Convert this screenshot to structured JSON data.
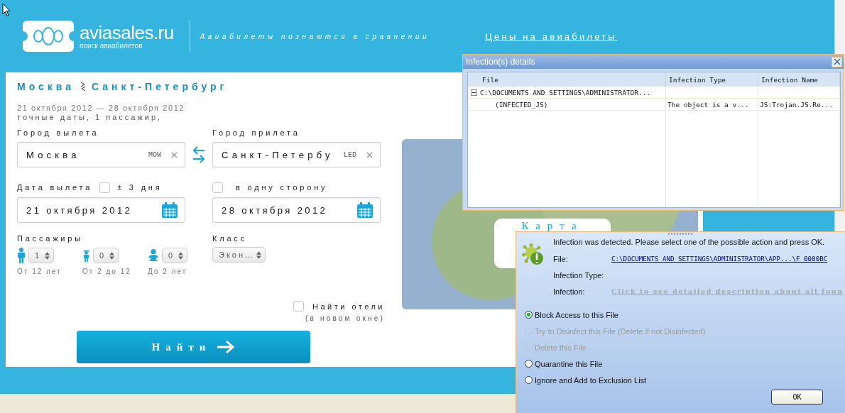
{
  "header": {
    "logo_text": "aviasales.ru",
    "logo_subtitle": "поиск авиабилетов",
    "tagline": "Авиабилеты познаются в сравнении",
    "prices_link": "Цены на авиабилеты"
  },
  "search": {
    "route_from": "Москва",
    "route_to": "Санкт-Петербург",
    "dates": "21 октября 2012  — 28 октября 2012",
    "summary": "точные даты, 1 пассажир,",
    "origin": {
      "label": "Город вылета",
      "value": "Москва",
      "code": "MOW"
    },
    "destination": {
      "label": "Город прилета",
      "value": "Санкт-Петербу",
      "code": "LED"
    },
    "depart": {
      "label": "Дата вылета",
      "value": "21 октября 2012"
    },
    "flex_dates": {
      "label": "± 3 дня",
      "checked": false
    },
    "one_way": {
      "label": "в одну сторону",
      "checked": false
    },
    "return": {
      "value": "28 октября 2012"
    },
    "passengers_label": "Пассажиры",
    "passengers": [
      {
        "kind": "adult",
        "count": "1",
        "note": "От 12 лет"
      },
      {
        "kind": "child",
        "count": "0",
        "note": "От 2 до 12"
      },
      {
        "kind": "infant",
        "count": "0",
        "note": "До 2 лет"
      }
    ],
    "class": {
      "label": "Класс",
      "value": "Экон…"
    },
    "hotels": {
      "label": "Найти отели",
      "note": "(в новом окне)",
      "checked": false
    },
    "submit": "Найти"
  },
  "map": {
    "popup_title": "Карта"
  },
  "details_window": {
    "title": "Infection(s) details",
    "columns": [
      "File",
      "Infection Type",
      "Infection Name"
    ],
    "rows": [
      {
        "file": "C:\\DOCUMENTS AND SETTINGS\\ADMINISTRATOR...",
        "expanded": true,
        "children": [
          {
            "file": "(INFECTED_JS)",
            "type": "The object is a v...",
            "name": "JS:Trojan.JS.Re..."
          }
        ]
      }
    ]
  },
  "alert": {
    "message": "Infection was detected. Please select one of the possible action and press OK.",
    "fields": [
      {
        "kind": "link",
        "label": "File:",
        "value": "C:\\DOCUMENTS AND SETTINGS\\ADMINISTRATOR\\APP...\\F 0000BC"
      },
      {
        "kind": "plain",
        "label": "Infection Type:"
      },
      {
        "kind": "disabled-link",
        "label": "Infection:",
        "value": "Click to see detailed description about all foun"
      }
    ],
    "options": [
      {
        "label": "Block Access to this File",
        "selected": true,
        "disabled": false
      },
      {
        "label": "Try to Disinfect this File (Delete if not Disinfected)",
        "selected": false,
        "disabled": true
      },
      {
        "label": "Delete this File",
        "selected": false,
        "disabled": true
      },
      {
        "label": "Quarantine this File",
        "selected": false,
        "disabled": false
      },
      {
        "label": "Ignore and Add to Exclusion List",
        "selected": false,
        "disabled": false
      }
    ],
    "ok_button": "OK"
  }
}
